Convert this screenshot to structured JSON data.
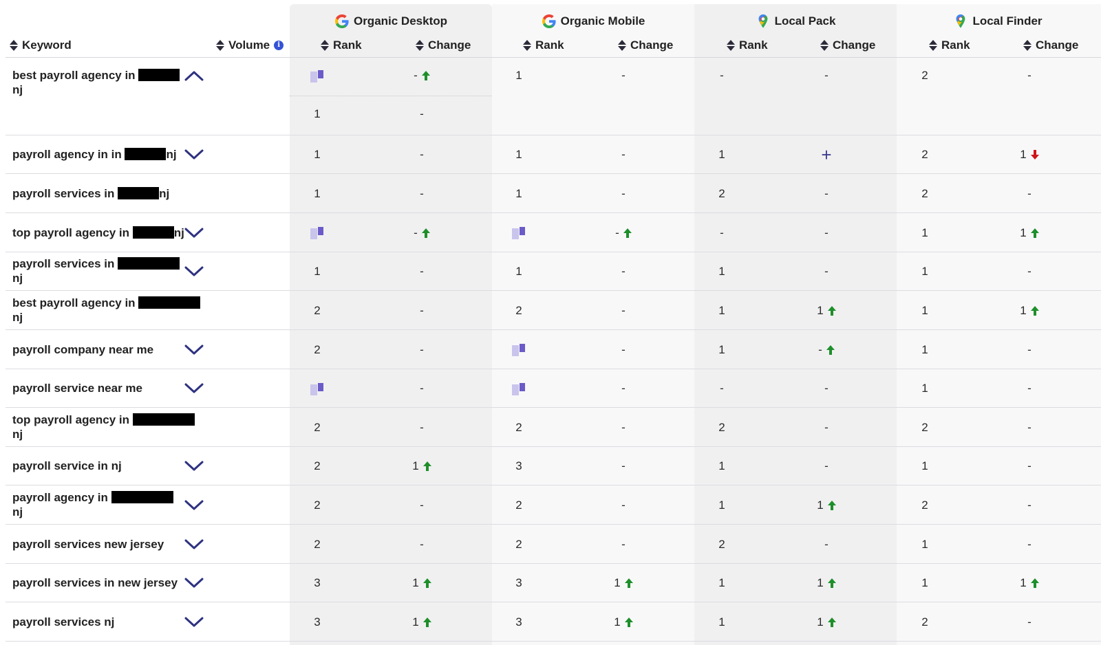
{
  "headers": {
    "keyword": "Keyword",
    "volume": "Volume",
    "volume_info": "i",
    "groups": [
      {
        "label": "Organic Desktop",
        "icon": "google-icon"
      },
      {
        "label": "Organic Mobile",
        "icon": "google-icon"
      },
      {
        "label": "Local Pack",
        "icon": "maps-pin-icon"
      },
      {
        "label": "Local Finder",
        "icon": "maps-pin-icon"
      }
    ],
    "rank": "Rank",
    "change": "Change"
  },
  "colors": {
    "accent": "#3a3f8f",
    "up_arrow": "#1e8f2a",
    "down_arrow": "#d0151b",
    "band_dark": "#f0f0f1",
    "band_light": "#f8f8f9"
  },
  "rows": [
    {
      "kw1": "best payroll agency in",
      "kw2": "nj",
      "od_rank": "",
      "od_change": "-",
      "om_rank": "1",
      "om_change": "-",
      "lp_rank": "-",
      "lp_change": "-",
      "lf_rank": "2",
      "lf_change": "-",
      "extra_rank": "1",
      "extra_change": "-"
    },
    {
      "kw1": "payroll agency in in",
      "kw2": "nj",
      "od_rank": "1",
      "od_change": "-",
      "om_rank": "1",
      "om_change": "-",
      "lp_rank": "1",
      "lp_change": "+",
      "lf_rank": "2",
      "lf_change": "1"
    },
    {
      "kw1": "payroll services in",
      "kw2": "nj",
      "od_rank": "1",
      "od_change": "-",
      "om_rank": "1",
      "om_change": "-",
      "lp_rank": "2",
      "lp_change": "-",
      "lf_rank": "2",
      "lf_change": "-"
    },
    {
      "kw1": "top payroll agency in",
      "kw2": "nj",
      "od_rank": "",
      "od_change": "-",
      "om_rank": "",
      "om_change": "-",
      "lp_rank": "-",
      "lp_change": "-",
      "lf_rank": "1",
      "lf_change": "1"
    },
    {
      "kw1": "payroll services in",
      "kw2": "nj",
      "od_rank": "1",
      "od_change": "-",
      "om_rank": "1",
      "om_change": "-",
      "lp_rank": "1",
      "lp_change": "-",
      "lf_rank": "1",
      "lf_change": "-"
    },
    {
      "kw1": "best payroll agency in",
      "kw2": "nj",
      "od_rank": "2",
      "od_change": "-",
      "om_rank": "2",
      "om_change": "-",
      "lp_rank": "1",
      "lp_change": "1",
      "lf_rank": "1",
      "lf_change": "1"
    },
    {
      "kw1": "payroll company near me",
      "kw2": "",
      "od_rank": "2",
      "od_change": "-",
      "om_rank": "",
      "om_change": "-",
      "lp_rank": "1",
      "lp_change": "-",
      "lf_rank": "1",
      "lf_change": "-"
    },
    {
      "kw1": "payroll service near me",
      "kw2": "",
      "od_rank": "",
      "od_change": "-",
      "om_rank": "",
      "om_change": "-",
      "lp_rank": "-",
      "lp_change": "-",
      "lf_rank": "1",
      "lf_change": "-"
    },
    {
      "kw1": "top payroll agency in",
      "kw2": "nj",
      "od_rank": "2",
      "od_change": "-",
      "om_rank": "2",
      "om_change": "-",
      "lp_rank": "2",
      "lp_change": "-",
      "lf_rank": "2",
      "lf_change": "-"
    },
    {
      "kw1": "payroll service in nj",
      "kw2": "",
      "od_rank": "2",
      "od_change": "1",
      "om_rank": "3",
      "om_change": "-",
      "lp_rank": "1",
      "lp_change": "-",
      "lf_rank": "1",
      "lf_change": "-"
    },
    {
      "kw1": "payroll agency in",
      "kw2": "nj",
      "od_rank": "2",
      "od_change": "-",
      "om_rank": "2",
      "om_change": "-",
      "lp_rank": "1",
      "lp_change": "1",
      "lf_rank": "2",
      "lf_change": "-"
    },
    {
      "kw1": "payroll services new jersey",
      "kw2": "",
      "od_rank": "2",
      "od_change": "-",
      "om_rank": "2",
      "om_change": "-",
      "lp_rank": "2",
      "lp_change": "-",
      "lf_rank": "1",
      "lf_change": "-"
    },
    {
      "kw1": "payroll services in new jersey",
      "kw2": "",
      "od_rank": "3",
      "od_change": "1",
      "om_rank": "3",
      "om_change": "1",
      "lp_rank": "1",
      "lp_change": "1",
      "lf_rank": "1",
      "lf_change": "1"
    },
    {
      "kw1": "payroll services nj",
      "kw2": "",
      "od_rank": "3",
      "od_change": "1",
      "om_rank": "3",
      "om_change": "1",
      "lp_rank": "1",
      "lp_change": "1",
      "lf_rank": "2",
      "lf_change": "-"
    }
  ]
}
